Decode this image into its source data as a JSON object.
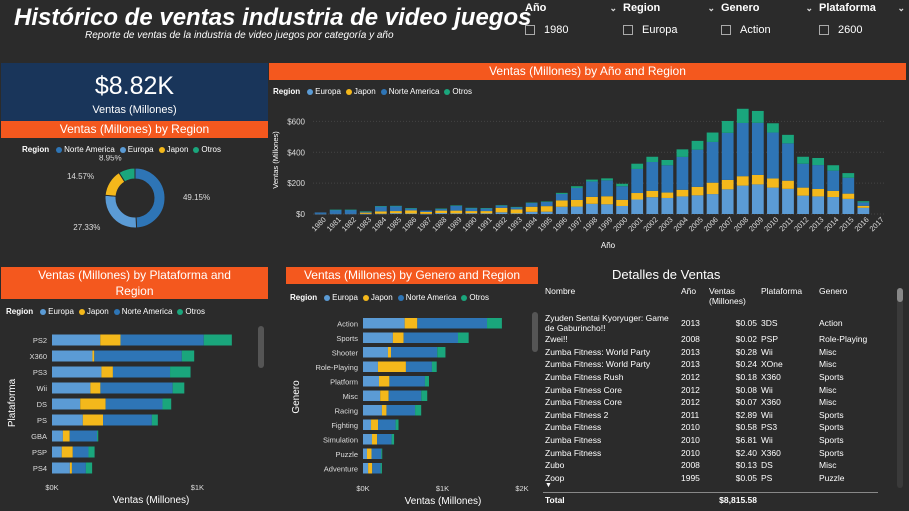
{
  "header": {
    "title": "Histórico de ventas industria de video juegos",
    "subtitle": "Reporte de ventas de la industria de video juegos por categoría y año"
  },
  "slicers": [
    {
      "label": "Año",
      "option": "1980"
    },
    {
      "label": "Region",
      "option": "Europa"
    },
    {
      "label": "Genero",
      "option": "Action"
    },
    {
      "label": "Plataforma",
      "option": "2600"
    }
  ],
  "kpi": {
    "value": "$8.82K",
    "label": "Ventas (Millones)"
  },
  "colors": {
    "europa": "#5b9bd5",
    "japon": "#f4b81b",
    "norte_america": "#2e75b6",
    "otros": "#1aa67c",
    "banner": "#f4581e",
    "kpi_bg": "#19355a"
  },
  "region_legend": {
    "title": "Region",
    "items": [
      "Europa",
      "Japon",
      "Norte America",
      "Otros"
    ]
  },
  "donut": {
    "banner": "Ventas (Millones) by Region",
    "legend": {
      "title": "Region",
      "items": [
        "Norte America",
        "Europa",
        "Japon",
        "Otros"
      ]
    },
    "chart_data": {
      "type": "pie",
      "categories": [
        "Norte America",
        "Europa",
        "Japon",
        "Otros"
      ],
      "values": [
        49.15,
        27.33,
        14.57,
        8.95
      ],
      "labels": [
        "49.15%",
        "27.33%",
        "14.57%",
        "8.95%"
      ]
    }
  },
  "yearly": {
    "banner": "Ventas (Millones) by Año and Region",
    "chart_data": {
      "type": "bar",
      "stacked": true,
      "xlabel": "Año",
      "ylabel": "Ventas (Millones)",
      "ylim": [
        0,
        700
      ],
      "yticks": [
        0,
        200,
        400,
        600
      ],
      "ytick_labels": [
        "$0",
        "$200",
        "$400",
        "$600"
      ],
      "categories": [
        "1980",
        "1981",
        "1982",
        "1983",
        "1984",
        "1985",
        "1986",
        "1987",
        "1988",
        "1989",
        "1990",
        "1991",
        "1992",
        "1993",
        "1994",
        "1995",
        "1996",
        "1997",
        "1998",
        "1999",
        "2000",
        "2001",
        "2002",
        "2003",
        "2004",
        "2005",
        "2006",
        "2007",
        "2008",
        "2009",
        "2010",
        "2011",
        "2012",
        "2013",
        "2014",
        "2015",
        "2016",
        "2017"
      ],
      "series": [
        {
          "name": "Europa",
          "values": [
            1,
            2,
            2,
            1,
            2,
            5,
            3,
            1,
            6,
            4,
            5,
            4,
            11,
            4,
            14,
            15,
            47,
            48,
            66,
            63,
            52,
            94,
            109,
            104,
            114,
            121,
            129,
            160,
            184,
            192,
            171,
            163,
            119,
            114,
            110,
            98,
            40,
            0
          ]
        },
        {
          "name": "Japon",
          "values": [
            0,
            0,
            0,
            8,
            15,
            14,
            20,
            12,
            16,
            18,
            14,
            15,
            29,
            26,
            33,
            36,
            41,
            43,
            45,
            52,
            40,
            42,
            41,
            35,
            43,
            55,
            74,
            61,
            61,
            61,
            59,
            53,
            52,
            48,
            40,
            34,
            13,
            0
          ]
        },
        {
          "name": "Norte America",
          "values": [
            9,
            25,
            25,
            7,
            33,
            33,
            13,
            9,
            12,
            32,
            20,
            18,
            15,
            15,
            25,
            27,
            42,
            78,
            100,
            103,
            88,
            156,
            187,
            177,
            213,
            241,
            264,
            305,
            345,
            338,
            298,
            242,
            155,
            155,
            131,
            103,
            22,
            0
          ]
        },
        {
          "name": "Otros",
          "values": [
            0,
            1,
            1,
            1,
            1,
            1,
            2,
            0,
            1,
            2,
            1,
            1,
            2,
            1,
            2,
            3,
            7,
            11,
            12,
            13,
            16,
            34,
            34,
            34,
            49,
            57,
            61,
            77,
            92,
            77,
            60,
            55,
            45,
            46,
            35,
            30,
            8,
            0
          ]
        }
      ]
    }
  },
  "platform": {
    "banner": "Ventas (Millones) by Plataforma and Region",
    "chart_data": {
      "type": "bar",
      "orientation": "horizontal",
      "stacked": true,
      "xlabel": "Ventas (Millones)",
      "ylabel": "Plataforma",
      "xlim": [
        0,
        1300
      ],
      "xticks": [
        0,
        1000
      ],
      "xtick_labels": [
        "$0K",
        "$1K"
      ],
      "categories": [
        "PS2",
        "X360",
        "PS3",
        "Wii",
        "DS",
        "PS",
        "GBA",
        "PSP",
        "PS4"
      ],
      "series": [
        {
          "name": "Europa",
          "values": [
            332,
            278,
            340,
            264,
            194,
            212,
            75,
            67,
            123
          ]
        },
        {
          "name": "Japon",
          "values": [
            139,
            13,
            79,
            69,
            175,
            139,
            47,
            76,
            14
          ]
        },
        {
          "name": "Norte America",
          "values": [
            573,
            602,
            393,
            497,
            391,
            336,
            188,
            108,
            96
          ]
        },
        {
          "name": "Otros",
          "values": [
            193,
            85,
            141,
            80,
            60,
            41,
            8,
            42,
            43
          ]
        }
      ]
    }
  },
  "genre": {
    "banner": "Ventas (Millones) by Genero and Region",
    "chart_data": {
      "type": "bar",
      "orientation": "horizontal",
      "stacked": true,
      "xlabel": "Ventas (Millones)",
      "ylabel": "Genero",
      "xlim": [
        0,
        2000
      ],
      "xticks": [
        0,
        1000,
        2000
      ],
      "xtick_labels": [
        "$0K",
        "$1K",
        "$2K"
      ],
      "categories": [
        "Action",
        "Sports",
        "Shooter",
        "Role-Playing",
        "Platform",
        "Misc",
        "Racing",
        "Fighting",
        "Simulation",
        "Puzzle",
        "Adventure"
      ],
      "series": [
        {
          "name": "Europa",
          "values": [
            524,
            376,
            314,
            188,
            201,
            216,
            238,
            101,
            113,
            50,
            64
          ]
        },
        {
          "name": "Japon",
          "values": [
            159,
            135,
            38,
            352,
            131,
            107,
            57,
            88,
            64,
            57,
            52
          ]
        },
        {
          "name": "Norte America",
          "values": [
            877,
            684,
            582,
            327,
            447,
            410,
            360,
            221,
            183,
            123,
            105
          ]
        },
        {
          "name": "Otros",
          "values": [
            187,
            134,
            103,
            60,
            51,
            75,
            77,
            37,
            31,
            12,
            17
          ]
        }
      ]
    }
  },
  "details": {
    "title": "Detalles de Ventas",
    "columns": [
      "Nombre",
      "Año",
      "Ventas (Millones)",
      "Plataforma",
      "Genero"
    ],
    "rows": [
      [
        "Zyuden Sentai Kyoryuger: Game de Gaburincho!!",
        "2013",
        "$0.05",
        "3DS",
        "Action"
      ],
      [
        "Zwei!!",
        "2008",
        "$0.02",
        "PSP",
        "Role-Playing"
      ],
      [
        "Zumba Fitness: World Party",
        "2013",
        "$0.28",
        "Wii",
        "Misc"
      ],
      [
        "Zumba Fitness: World Party",
        "2013",
        "$0.24",
        "XOne",
        "Misc"
      ],
      [
        "Zumba Fitness Rush",
        "2012",
        "$0.18",
        "X360",
        "Sports"
      ],
      [
        "Zumba Fitness Core",
        "2012",
        "$0.08",
        "Wii",
        "Misc"
      ],
      [
        "Zumba Fitness Core",
        "2012",
        "$0.07",
        "X360",
        "Misc"
      ],
      [
        "Zumba Fitness 2",
        "2011",
        "$2.89",
        "Wii",
        "Sports"
      ],
      [
        "Zumba Fitness",
        "2010",
        "$0.58",
        "PS3",
        "Sports"
      ],
      [
        "Zumba Fitness",
        "2010",
        "$6.81",
        "Wii",
        "Sports"
      ],
      [
        "Zumba Fitness",
        "2010",
        "$2.40",
        "X360",
        "Sports"
      ],
      [
        "Zubo",
        "2008",
        "$0.13",
        "DS",
        "Misc"
      ],
      [
        "Zoop",
        "1995",
        "$0.05",
        "PS",
        "Puzzle"
      ]
    ],
    "total_label": "Total",
    "total_value": "$8,815.58"
  }
}
